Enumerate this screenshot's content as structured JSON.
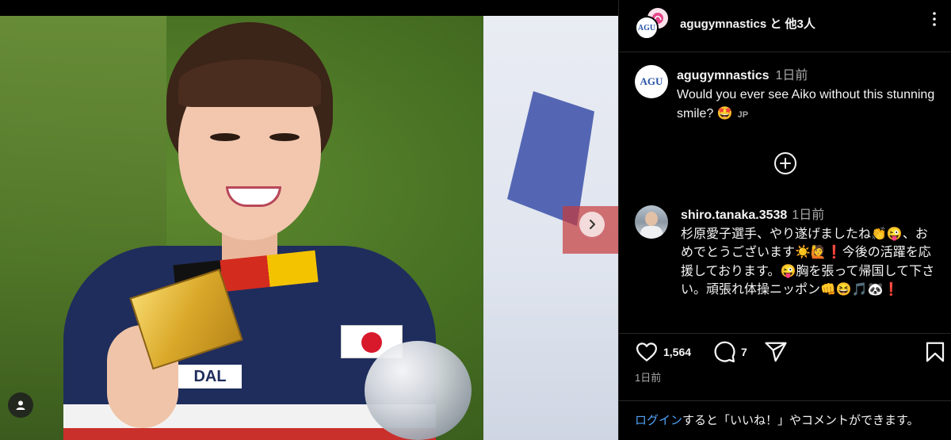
{
  "post": {
    "header": {
      "title": "agugymnastics と 他3人",
      "avatar_logo": "AGU"
    },
    "caption": {
      "username": "agugymnastics",
      "time": "1日前",
      "text": "Would you ever see Aiko without this stunning smile? 🤩",
      "lang_badge": "JP"
    },
    "media": {
      "sponsor_text": "DAL"
    },
    "comments": [
      {
        "username": "shiro.tanaka.3538",
        "time": "1日前",
        "text": "杉原愛子選手、やり遂げましたね👏😜、おめでとうございます☀️🙋❗今後の活躍を応援しております。😜胸を張って帰国して下さい。頑張れ体操ニッポン👊😆🎵🐼❗"
      }
    ],
    "actions": {
      "like_count": "1,564",
      "comment_count": "7"
    },
    "timestamp": "1日前",
    "login_prompt": {
      "link": "ログイン",
      "rest": "すると「いいね！」やコメントができます。"
    }
  },
  "icons": {
    "next": "chevron-right-icon",
    "tag": "user-tag-icon",
    "more": "more-options-icon",
    "load_more": "plus-circle-icon",
    "like": "heart-icon",
    "comment": "comment-icon",
    "share": "share-icon",
    "save": "bookmark-icon"
  },
  "colors": {
    "background": "#000000",
    "text": "#f5f5f5",
    "muted": "#a8a8a8",
    "link": "#4fa3f7",
    "divider": "#262626"
  }
}
